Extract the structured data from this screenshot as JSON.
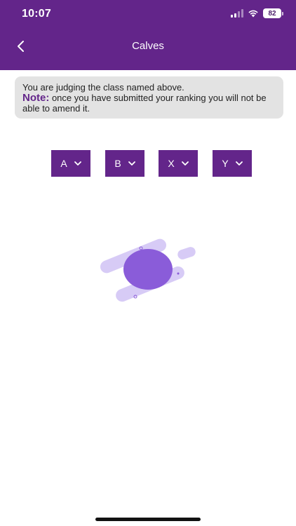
{
  "status_bar": {
    "time": "10:07",
    "battery": "82"
  },
  "header": {
    "title": "Calves",
    "back_icon": "chevron-left-icon"
  },
  "note": {
    "line1": "You are judging the class named above.",
    "label": "Note:",
    "text": " once you have submitted your ranking you will not be able to amend it."
  },
  "rank_selectors": [
    {
      "value": "A"
    },
    {
      "value": "B"
    },
    {
      "value": "X"
    },
    {
      "value": "Y"
    }
  ],
  "colors": {
    "brand_purple": "#63258a",
    "note_background": "#e3e3e3",
    "illustration_primary": "#8a5cd9",
    "illustration_light": "#d7cbf6"
  }
}
